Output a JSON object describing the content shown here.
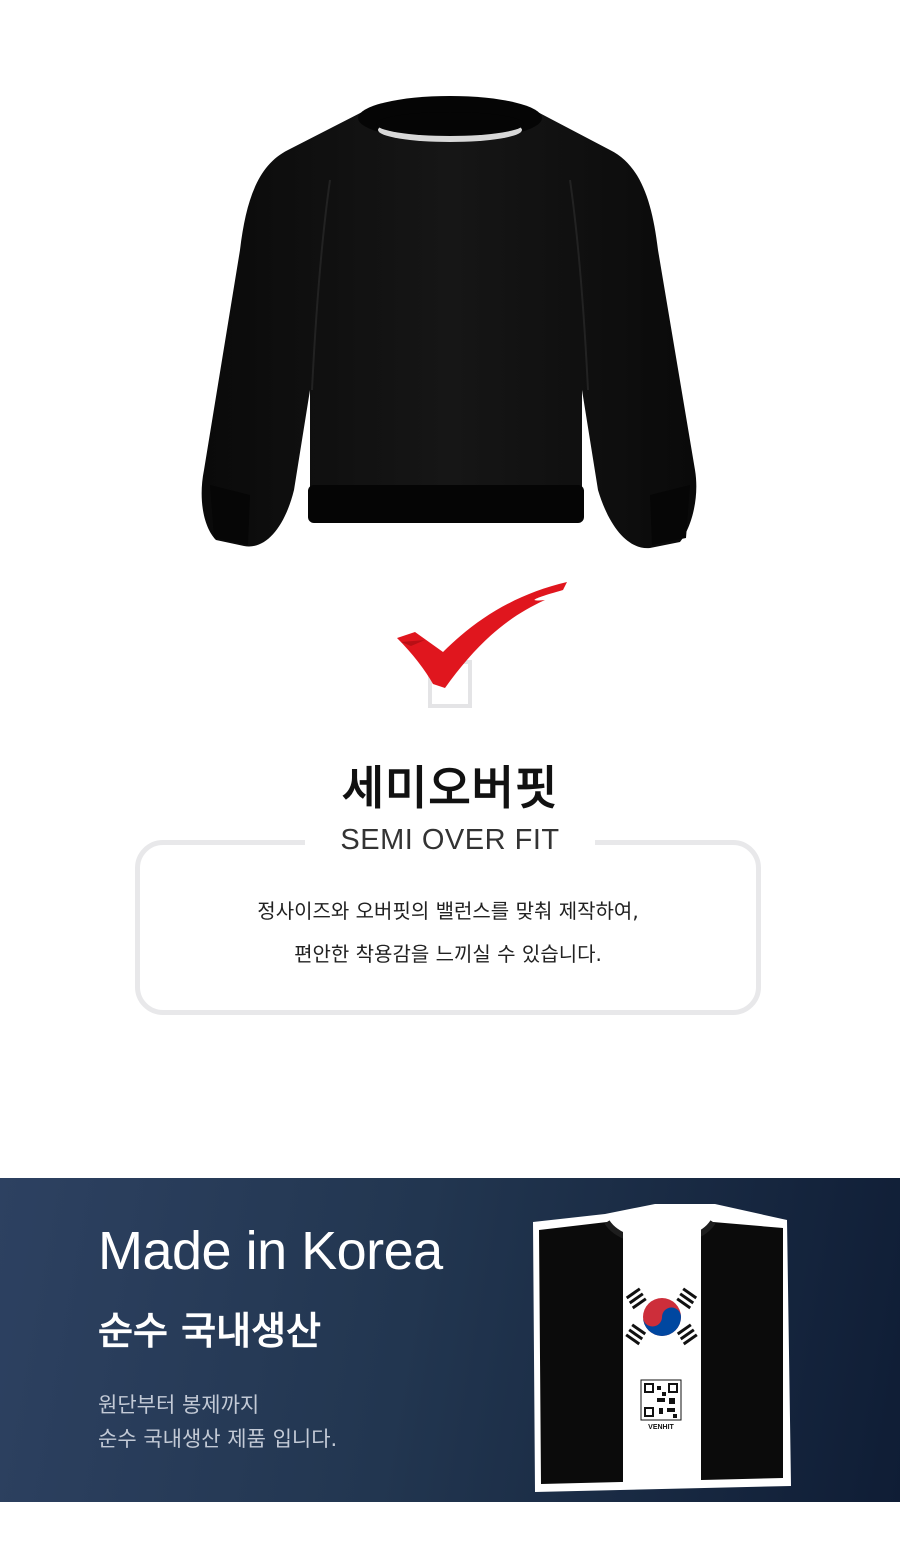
{
  "product": {
    "image_icon": "black-sweatshirt-image"
  },
  "fit": {
    "check_icon": "red-checkmark-icon",
    "title": "세미오버핏",
    "subtitle": "SEMI OVER FIT",
    "description_lines": [
      "정사이즈와 오버핏의 밸런스를 맞춰 제작하여,",
      "편안한 착용감을 느끼실 수 있습니다."
    ]
  },
  "made": {
    "heading_en": "Made in Korea",
    "heading_ko": "순수 국내생산",
    "description_lines": [
      "원단부터 봉제까지",
      "순수 국내생산 제품 입니다."
    ],
    "label_brand": "VENHIT",
    "image_icon": "folded-shirt-korean-flag-image"
  },
  "colors": {
    "check_red": "#e0161e",
    "banner_dark": "#1b2c46",
    "box_border": "#e8e8ea"
  }
}
